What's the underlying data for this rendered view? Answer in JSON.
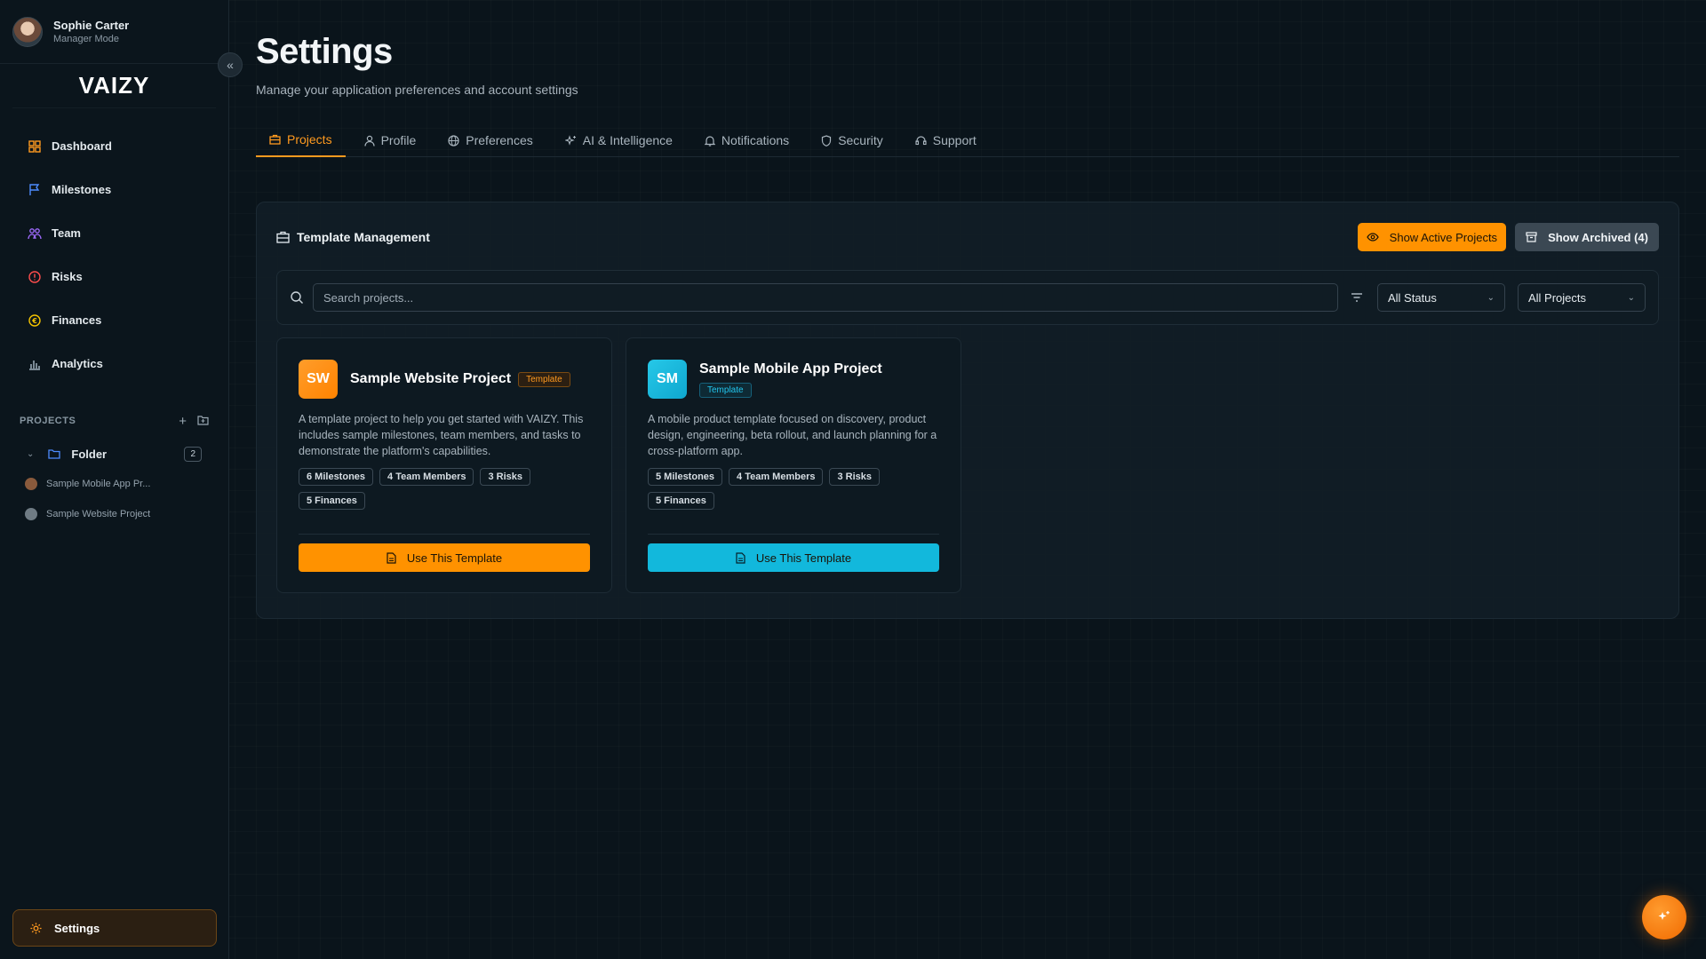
{
  "user": {
    "name": "Sophie Carter",
    "role": "Manager Mode"
  },
  "brand": {
    "logo_text": "VAIZY"
  },
  "sidebar": {
    "nav": [
      {
        "label": "Dashboard",
        "icon": "dashboard-icon"
      },
      {
        "label": "Milestones",
        "icon": "flag-icon"
      },
      {
        "label": "Team",
        "icon": "team-icon"
      },
      {
        "label": "Risks",
        "icon": "alert-icon"
      },
      {
        "label": "Finances",
        "icon": "coin-icon"
      },
      {
        "label": "Analytics",
        "icon": "chart-icon"
      }
    ],
    "projects_title": "PROJECTS",
    "folder": {
      "label": "Folder",
      "count": "2"
    },
    "projects": [
      {
        "label": "Sample Mobile App Pr...",
        "color": "#8a5a3c"
      },
      {
        "label": "Sample Website Project",
        "color": "#6f7b84"
      }
    ],
    "settings_label": "Settings"
  },
  "page": {
    "title": "Settings",
    "subtitle": "Manage your application preferences and account settings"
  },
  "tabs": [
    {
      "label": "Projects",
      "icon": "briefcase-icon",
      "active": true
    },
    {
      "label": "Profile",
      "icon": "user-icon"
    },
    {
      "label": "Preferences",
      "icon": "globe-icon"
    },
    {
      "label": "AI & Intelligence",
      "icon": "sparkle-icon"
    },
    {
      "label": "Notifications",
      "icon": "bell-icon"
    },
    {
      "label": "Security",
      "icon": "shield-icon"
    },
    {
      "label": "Support",
      "icon": "headset-icon"
    }
  ],
  "panel": {
    "title": "Template Management",
    "show_active_label": "Show Active Projects",
    "show_archived_label": "Show Archived (4)",
    "search_placeholder": "Search projects...",
    "status_filter": "All Status",
    "project_filter": "All Projects"
  },
  "cards": [
    {
      "initials": "SW",
      "title": "Sample Website Project",
      "tag": "Template",
      "description": "A template project to help you get started with VAIZY. This includes sample milestones, team members, and tasks to demonstrate the platform's capabilities.",
      "stats": [
        "6 Milestones",
        "4 Team Members",
        "3 Risks",
        "5 Finances"
      ],
      "button_label": "Use This Template",
      "accent": "#ff9200"
    },
    {
      "initials": "SM",
      "title": "Sample Mobile App Project",
      "tag": "Template",
      "description": "A mobile product template focused on discovery, product design, engineering, beta rollout, and launch planning for a cross-platform app.",
      "stats": [
        "5 Milestones",
        "4 Team Members",
        "3 Risks",
        "5 Finances"
      ],
      "button_label": "Use This Template",
      "accent": "#12b8dc"
    }
  ]
}
